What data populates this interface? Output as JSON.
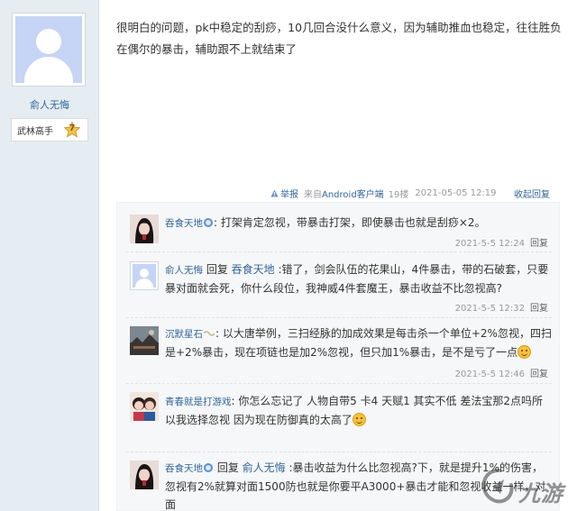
{
  "author": {
    "name": "俞人无悔",
    "rank_title": "武林高手",
    "rank_level": "7"
  },
  "post": {
    "text": "很明白的问题，pk中稳定的刮痧，10几回合没什么意义，因为辅助推血也稳定，往往胜负在偶尔的暴击，辅助跟不上就结束了",
    "meta": {
      "report_label": "举报",
      "from_prefix": "来自",
      "from_client": "Android客户端",
      "floor": "19楼",
      "time": "2021-05-05 12:19",
      "collapse_label": "收起回复"
    }
  },
  "replies": [
    {
      "nick": "吞食天地",
      "badge": "member-badge-icon",
      "has_reply_to": false,
      "reply_word": "",
      "target": "",
      "content": ": 打架肯定忽视，带暴击打架，即使暴击也就是刮痧×2。",
      "time": "2021-5-5 12:24",
      "reply_label": "回复",
      "avatar": "dark-hair-avatar"
    },
    {
      "nick": "俞人无悔",
      "badge": "",
      "has_reply_to": true,
      "reply_word": "回复",
      "target": "吞食天地",
      "content": ":错了，剑会队伍的花果山，4件暴击，带的石破套，只要暴对面就会死，你什么段位，我神威4件套魔王，暴击收益不比忽视高?",
      "time": "2021-5-5 12:32",
      "reply_label": "回复",
      "avatar": "default-avatar"
    },
    {
      "nick": "沉默星石",
      "badge": "wave-icon",
      "has_reply_to": false,
      "reply_word": "",
      "target": "",
      "content": ": 以大唐举例，三扫经脉的加成效果是每击杀一个单位+2%忽视，四扫是+2%暴击，现在项链也是加2%忽视，但只加1%暴击，是不是亏了一点",
      "time": "2021-5-5 12:46",
      "reply_label": "回复",
      "avatar": "landscape-avatar"
    },
    {
      "nick": "青春就是打游戏",
      "badge": "",
      "has_reply_to": false,
      "reply_word": "",
      "target": "",
      "content": ": 你怎么忘记了 人物自带5 卡4 天赋1 其实不低 差法宝那2点吗所以我选择忽视 因为现在防御真的太高了",
      "time": "",
      "reply_label": "",
      "avatar": "couple-avatar"
    },
    {
      "nick": "吞食天地",
      "badge": "member-badge-icon",
      "has_reply_to": true,
      "reply_word": "回复",
      "target": "俞人无悔",
      "content": ":暴击收益为什么比忽视高?下，就是提升1%的伤害，忽视有2%就算对面1500防也就是你要平A3000+暴击才能和忽视收益一样，对面",
      "time": "",
      "reply_label": "",
      "avatar": "dark-hair-avatar"
    }
  ],
  "watermark": {
    "text": "九游",
    "logo": "jiuyou-logo-icon"
  },
  "colors": {
    "link": "#336699",
    "sidebar_bg": "#e5edf2",
    "subpanel_bg": "#f6f7f8"
  }
}
